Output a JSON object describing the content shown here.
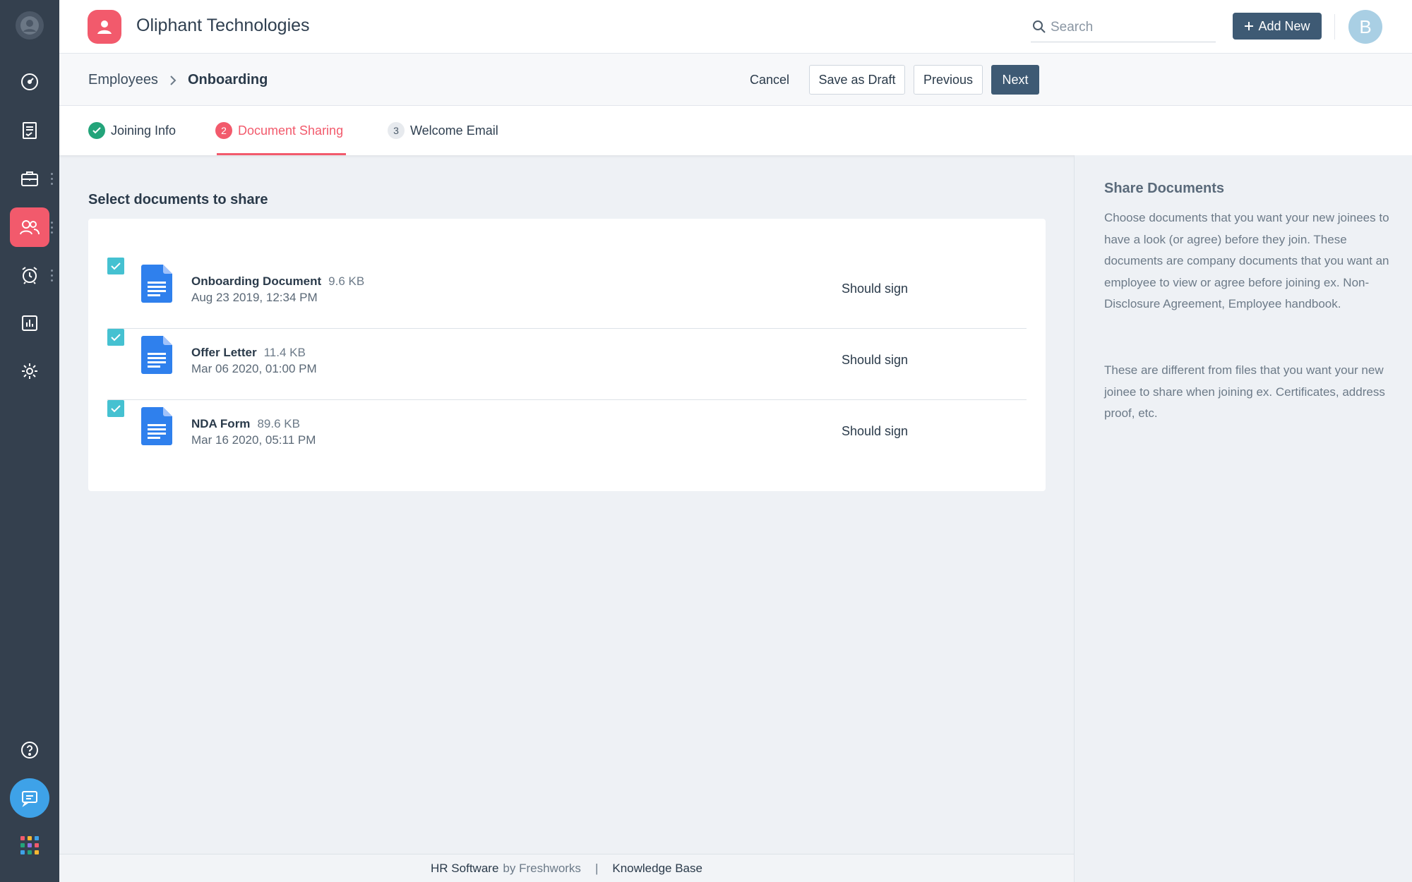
{
  "app": {
    "company_name": "Oliphant Technologies",
    "avatar_initial": "B"
  },
  "search": {
    "placeholder": "Search"
  },
  "header": {
    "add_new_label": "Add New"
  },
  "breadcrumb": {
    "parent": "Employees",
    "current": "Onboarding"
  },
  "actions": {
    "cancel": "Cancel",
    "save_draft": "Save as Draft",
    "previous": "Previous",
    "next": "Next"
  },
  "steps": [
    {
      "number": "1",
      "label": "Joining Info",
      "state": "done"
    },
    {
      "number": "2",
      "label": "Document Sharing",
      "state": "active"
    },
    {
      "number": "3",
      "label": "Welcome Email",
      "state": "pending"
    }
  ],
  "documents": {
    "title": "Select documents to share",
    "items": [
      {
        "name": "Onboarding Document",
        "size": "9.6 KB",
        "date": "Aug 23 2019, 12:34 PM",
        "action": "Should sign",
        "checked": true
      },
      {
        "name": "Offer Letter",
        "size": "11.4 KB",
        "date": "Mar 06 2020, 01:00 PM",
        "action": "Should sign",
        "checked": true
      },
      {
        "name": "NDA Form",
        "size": "89.6 KB",
        "date": "Mar 16 2020, 05:11 PM",
        "action": "Should sign",
        "checked": true
      }
    ]
  },
  "info_panel": {
    "title": "Share Documents",
    "paragraph_1": "Choose documents that you want your new joinees to have a look (or agree) before they join. These documents are company documents that you want an employee to view or agree before joining ex. Non-Disclosure Agreement, Employee handbook.",
    "paragraph_2": "These are different from files that you want your new joinee to share when joining ex. Certificates, address proof, etc."
  },
  "footer": {
    "product": "HR Software",
    "by": "by Freshworks",
    "separator": "|",
    "knowledge_base": "Knowledge Base"
  },
  "colors": {
    "brand": "#f25a6c",
    "primary_button": "#3e5a74",
    "success": "#23a47a",
    "checkbox": "#45c1d1",
    "doc_icon": "#2f80ed",
    "nav_bg": "#34404e"
  },
  "icons": {
    "nav": [
      "dashboard-icon",
      "document-list-icon",
      "briefcase-icon",
      "people-icon",
      "alarm-clock-icon",
      "report-icon",
      "gear-icon"
    ],
    "bottom": [
      "help-icon",
      "chat-icon",
      "apps-grid-icon"
    ]
  }
}
